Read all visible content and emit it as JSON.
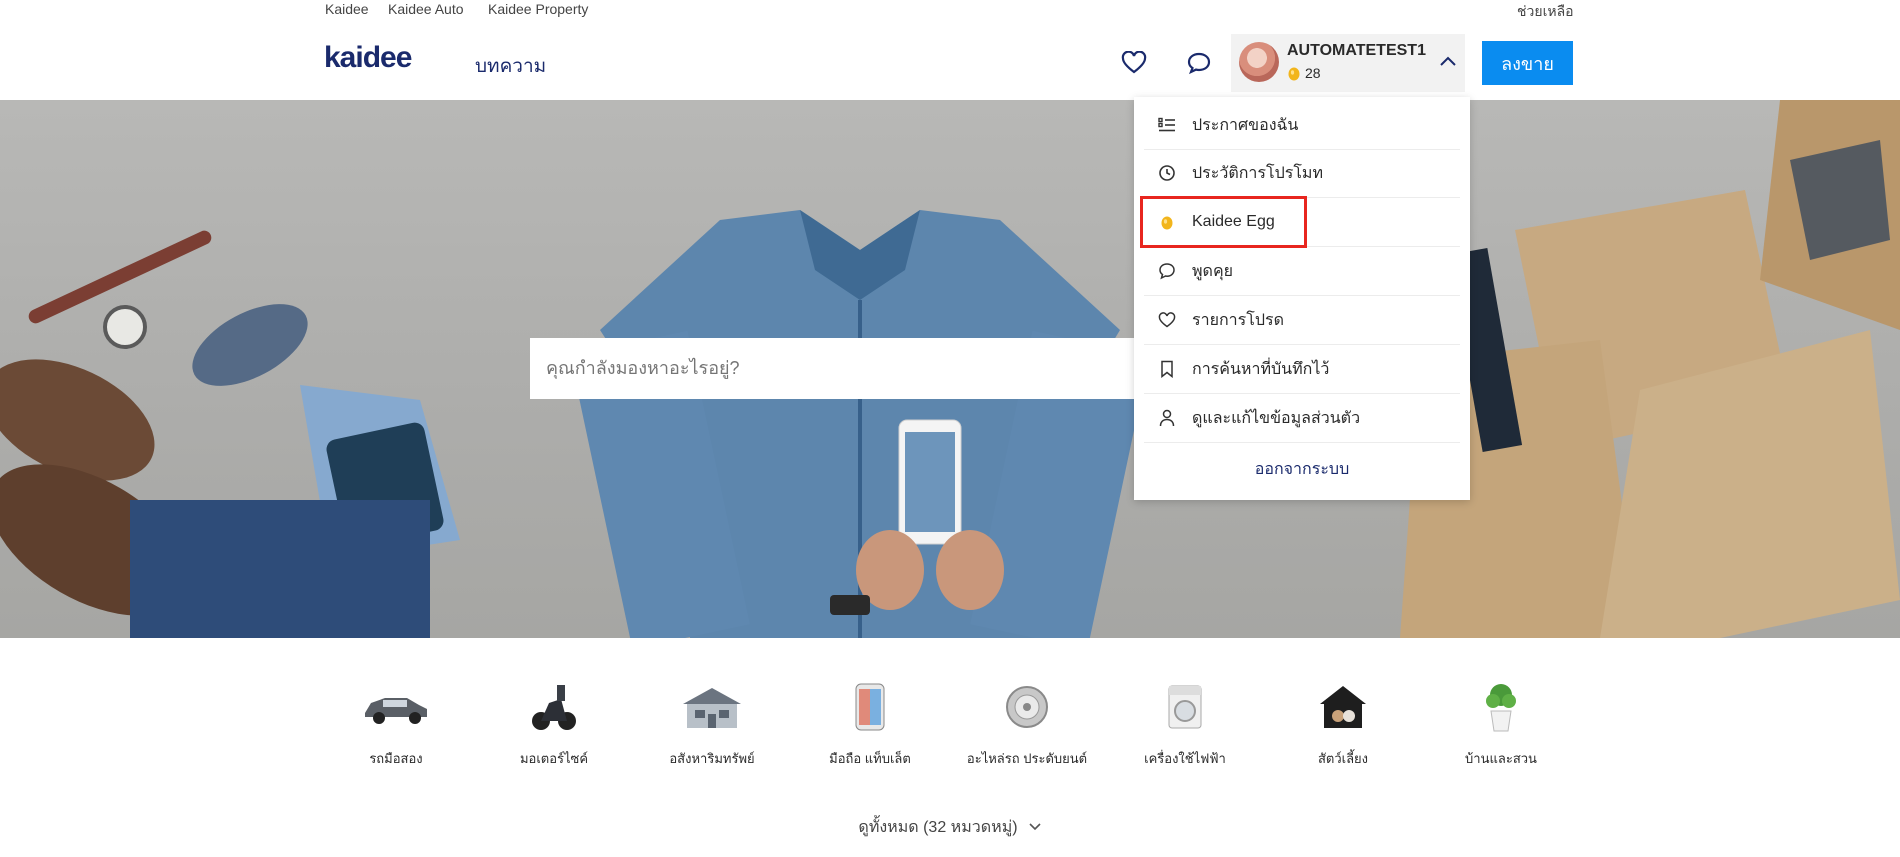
{
  "topbar": {
    "links": [
      "Kaidee",
      "Kaidee Auto",
      "Kaidee Property"
    ],
    "help": "ช่วยเหลือ"
  },
  "header": {
    "logo": "kaidee",
    "article_link": "บทความ",
    "username": "AUTOMATETEST1",
    "egg_count": "28",
    "sell_button": "ลงขาย"
  },
  "search": {
    "placeholder": "คุณกำลังมองหาอะไรอยู่?"
  },
  "dropdown": {
    "items": [
      {
        "label": "ประกาศของฉัน",
        "icon": "list-icon"
      },
      {
        "label": "ประวัติการโปรโมท",
        "icon": "history-icon"
      },
      {
        "label": "Kaidee Egg",
        "icon": "egg-icon"
      },
      {
        "label": "พูดคุย",
        "icon": "chat-icon"
      },
      {
        "label": "รายการโปรด",
        "icon": "heart-icon"
      },
      {
        "label": "การค้นหาที่บันทึกไว้",
        "icon": "bookmark-icon"
      },
      {
        "label": "ดูและแก้ไขข้อมูลส่วนตัว",
        "icon": "person-icon"
      }
    ],
    "logout": "ออกจากระบบ"
  },
  "categories": [
    {
      "label": "รถมือสอง",
      "icon": "car-icon"
    },
    {
      "label": "มอเตอร์ไซค์",
      "icon": "motorcycle-icon"
    },
    {
      "label": "อสังหาริมทรัพย์",
      "icon": "house-icon"
    },
    {
      "label": "มือถือ แท็บเล็ต",
      "icon": "phone-icon"
    },
    {
      "label": "อะไหล่รถ ประดับยนต์",
      "icon": "wheel-icon"
    },
    {
      "label": "เครื่องใช้ไฟฟ้า",
      "icon": "washer-icon"
    },
    {
      "label": "สัตว์เลี้ยง",
      "icon": "pet-icon"
    },
    {
      "label": "บ้านและสวน",
      "icon": "plant-icon"
    }
  ],
  "view_all": "ดูทั้งหมด (32 หมวดหมู่)",
  "colors": {
    "brand_blue": "#0a8cf0",
    "navy": "#1a2a6c",
    "highlight_red": "#e8261f",
    "egg_yellow": "#f2b51c"
  }
}
